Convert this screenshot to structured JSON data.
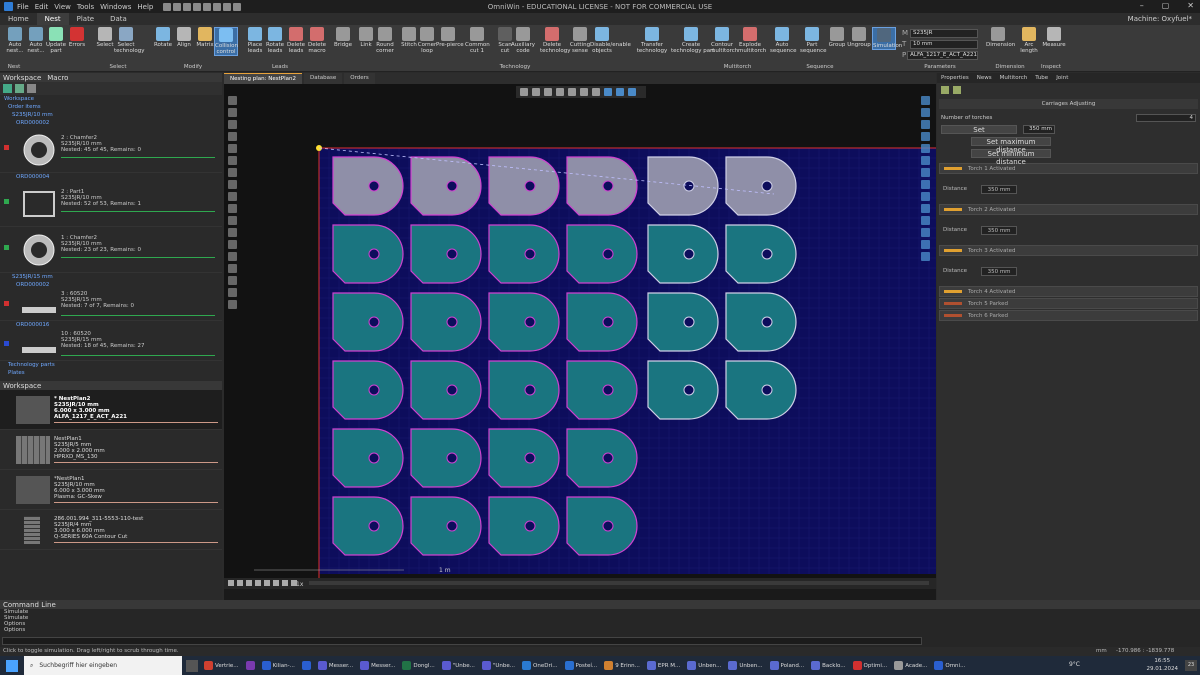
{
  "app": {
    "title": "OmniWin - EDUCATIONAL LICENSE - NOT FOR COMMERCIAL USE",
    "menu": [
      "File",
      "Edit",
      "View",
      "Tools",
      "Windows",
      "Help"
    ],
    "machine": "Machine: Oxyfuel*"
  },
  "tabs": [
    "Home",
    "Nest",
    "Plate",
    "Data"
  ],
  "active_tab": "Nest",
  "ribbon": {
    "buttons": [
      {
        "id": "auto-nest",
        "label": "Auto\nnest..."
      },
      {
        "id": "auto-nest-2",
        "label": "Auto\nnest..."
      },
      {
        "id": "update-part",
        "label": "Update\npart"
      },
      {
        "id": "errors",
        "label": "Errors"
      },
      {
        "id": "select",
        "label": "Select"
      },
      {
        "id": "select-technology",
        "label": "Select\ntechnology"
      },
      {
        "id": "rotate",
        "label": "Rotate"
      },
      {
        "id": "align",
        "label": "Align"
      },
      {
        "id": "matrix",
        "label": "Matrix"
      },
      {
        "id": "collision-control",
        "label": "Collision\ncontrol"
      },
      {
        "id": "place-leads",
        "label": "Place\nleads"
      },
      {
        "id": "rotate-leads",
        "label": "Rotate\nleads"
      },
      {
        "id": "delete-leads",
        "label": "Delete\nleads"
      },
      {
        "id": "delete-macro",
        "label": "Delete\nmacro"
      },
      {
        "id": "bridge",
        "label": "Bridge"
      },
      {
        "id": "link",
        "label": "Link"
      },
      {
        "id": "round-corner",
        "label": "Round\ncorner"
      },
      {
        "id": "stitch",
        "label": "Stitch"
      },
      {
        "id": "corner-loop",
        "label": "Corner\nloop"
      },
      {
        "id": "pre-pierce",
        "label": "Pre-pierce"
      },
      {
        "id": "common-cut",
        "label": "Common\ncut 1"
      },
      {
        "id": "scan-cut",
        "label": "Scan\ncut"
      },
      {
        "id": "auxiliary-code",
        "label": "Auxiliary\ncode"
      },
      {
        "id": "delete-technology",
        "label": "Delete\ntechnology"
      },
      {
        "id": "cutting-sense",
        "label": "Cutting\nsense"
      },
      {
        "id": "disable-enable-objects",
        "label": "Disable/enable\nobjects"
      },
      {
        "id": "transfer-technology",
        "label": "Transfer\ntechnology"
      },
      {
        "id": "create-technology-part",
        "label": "Create\ntechnology part"
      },
      {
        "id": "contour-multitorch",
        "label": "Contour\nmultitorch"
      },
      {
        "id": "explode-multitorch",
        "label": "Explode\nmultitorch"
      },
      {
        "id": "auto-sequence",
        "label": "Auto\nsequence"
      },
      {
        "id": "part-sequence",
        "label": "Part\nsequence"
      },
      {
        "id": "group",
        "label": "Group"
      },
      {
        "id": "ungroup",
        "label": "Ungroup"
      },
      {
        "id": "simulation",
        "label": "Simulation"
      },
      {
        "id": "dimension",
        "label": "Dimension"
      },
      {
        "id": "arc-length",
        "label": "Arc\nlength"
      },
      {
        "id": "measure",
        "label": "Measure"
      }
    ],
    "groups": [
      "Nest",
      "Select",
      "Modify",
      "Leads",
      "Technology",
      "Multitorch",
      "Sequence",
      "Parameters",
      "Dimension",
      "Inspect"
    ],
    "parameters": {
      "material": "S235JR",
      "thickness": "10 mm",
      "program": "ALFA_1217_E_ACT_A221"
    }
  },
  "left_panel": {
    "tabs": [
      "Workspace",
      "Macro"
    ],
    "tree": {
      "workspace": "Workspace",
      "order_items": "Order items",
      "material_group_1": "S235JR/10 mm",
      "order_1": "ORD000002",
      "order_2": "ORD000004",
      "material_group_2": "S235JR/15 mm",
      "order_3": "ORD000002",
      "order_4": "ORD000016",
      "technology_parts": "Technology parts",
      "plates": "Plates"
    },
    "items": [
      {
        "name": "2 : Chamfer2",
        "material": "S235JR/10 mm",
        "nested": "Nested: 45 of 45, Remains: 0",
        "color": "#d13030"
      },
      {
        "name": "2 : Part1",
        "material": "S235JR/10 mm",
        "nested": "Nested: 52 of 53, Remains: 1",
        "color": "#2fa84f"
      },
      {
        "name": "1 : Chamfer2",
        "material": "S235JR/10 mm",
        "nested": "Nested: 23 of 23, Remains: 0",
        "color": "#2fa84f"
      },
      {
        "name": "3 : 60520",
        "material": "S235JR/15 mm",
        "nested": "Nested: 7 of 7, Remains: 0",
        "color": "#d13030"
      },
      {
        "name": "10 : 60520",
        "material": "S235JR/15 mm",
        "nested": "Nested: 18 of 45, Remains: 27",
        "color": "#2a4ad1"
      }
    ],
    "workspace_title": "Workspace",
    "nests": [
      {
        "name": "* NestPlan2",
        "material": "S235JR/10 mm",
        "size": "6.000 x 3.000 mm",
        "program": "ALFA_1217_E_ACT_A221"
      },
      {
        "name": "NestPlan1",
        "material": "S235JR/5 mm",
        "size": "2.000 x 2.000 mm",
        "program": "HPRXD_MS_130"
      },
      {
        "name": "*NestPlan1",
        "material": "S235JR/10 mm",
        "size": "6.000 x 3.000 mm",
        "program": "Plasma: GC-Skew"
      },
      {
        "name": "286.001.994_311-5553-110-test",
        "material": "S235JR/4 mm",
        "size": "3.000 x 6.000 mm",
        "program": "Q-SERIES 60A Contour Cut"
      }
    ]
  },
  "doc_tabs": [
    "Nesting plan: NestPlan2",
    "Database",
    "Orders"
  ],
  "canvas": {
    "scale_label": "1 m",
    "playback_speed": "1x"
  },
  "right_panel": {
    "tabs": [
      "Properties",
      "News",
      "Multitorch",
      "Tube",
      "Joint"
    ],
    "title": "Carriages Adjusting",
    "number_of_torches_label": "Number of torches",
    "number_of_torches": "4",
    "set_label": "Set",
    "set_value": "350 mm",
    "set_max": "Set maximum distance",
    "set_min": "Set minimum distance",
    "distance_label": "Distance",
    "torches": [
      {
        "label": "Torch 1 Activated",
        "distance": "350 mm"
      },
      {
        "label": "Torch 2 Activated",
        "distance": "350 mm"
      },
      {
        "label": "Torch 3 Activated",
        "distance": "350 mm"
      },
      {
        "label": "Torch 4 Activated",
        "distance": ""
      },
      {
        "label": "Torch 5 Parked",
        "distance": ""
      },
      {
        "label": "Torch 6 Parked",
        "distance": ""
      }
    ]
  },
  "command_line": {
    "title": "Command Line",
    "lines": [
      "Simulate",
      "Simulate",
      "Options",
      "Options"
    ]
  },
  "status": {
    "text": "Click to toggle simulation. Drag left/right to scrub through time.",
    "units": "mm",
    "coords": "-170.986 : -1839.778"
  },
  "taskbar": {
    "search_placeholder": "Suchbegriff hier eingeben",
    "apps": [
      "Vertrie...",
      "",
      "Kilian-...",
      "",
      "Messer...",
      "Messer...",
      "Dongl...",
      "\"Unbe...",
      "\"Unbe...",
      "OneDri...",
      "Posteí...",
      "9 Erinn...",
      "EPR M...",
      "Unben...",
      "Unben...",
      "Poland...",
      "Backlo...",
      "Optimi...",
      "Acade...",
      "Omni..."
    ],
    "temperature": "9°C",
    "time": "16:55",
    "date": "29.01.2024",
    "notification_count": "23"
  }
}
